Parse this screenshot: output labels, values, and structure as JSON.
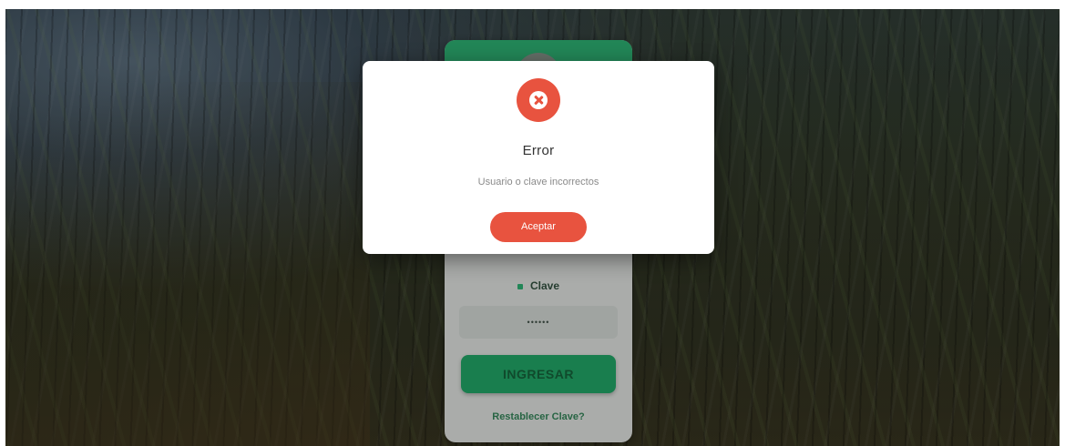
{
  "login": {
    "password_label": "Clave",
    "password_value": "••••••",
    "submit_label": "INGRESAR",
    "reset_link": "Restablecer Clave?"
  },
  "dialog": {
    "icon": "error-x-icon",
    "title": "Error",
    "message": "Usuario o clave incorrectos",
    "accept_label": "Aceptar"
  },
  "colors": {
    "accent_green": "#2aa36a",
    "error_red": "#e8533f"
  }
}
